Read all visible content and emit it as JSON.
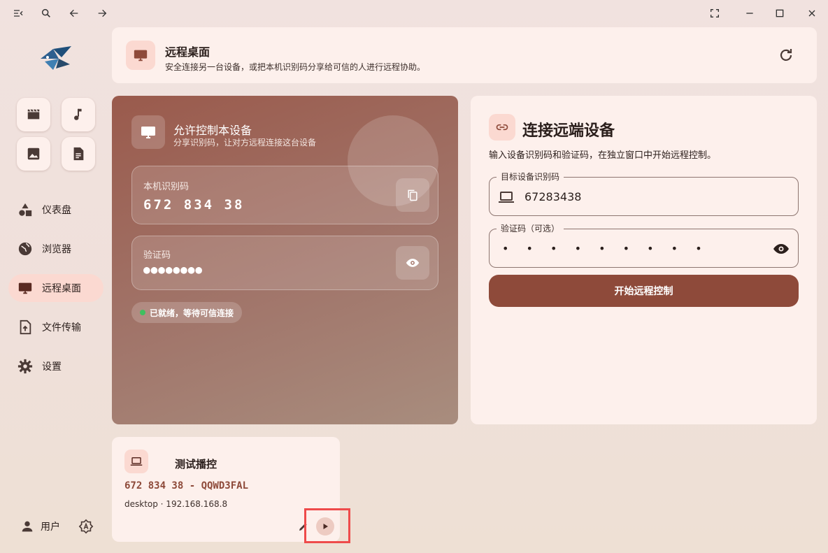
{
  "window": {
    "controls": [
      "menu-icon",
      "search-icon",
      "back-icon",
      "forward-icon",
      "fullscreen-icon",
      "minimize-icon",
      "maximize-icon",
      "close-icon"
    ]
  },
  "sidebar": {
    "quick": [
      "video-icon",
      "music-icon",
      "image-icon",
      "document-icon"
    ],
    "items": [
      {
        "label": "仪表盘",
        "icon": "dashboard-icon",
        "active": false
      },
      {
        "label": "浏览器",
        "icon": "globe-icon",
        "active": false
      },
      {
        "label": "远程桌面",
        "icon": "monitor-icon",
        "active": true
      },
      {
        "label": "文件传输",
        "icon": "file-upload-icon",
        "active": false
      },
      {
        "label": "设置",
        "icon": "gear-icon",
        "active": false
      }
    ],
    "user_label": "用户"
  },
  "header": {
    "title": "远程桌面",
    "subtitle": "安全连接另一台设备，或把本机识别码分享给可信的人进行远程协助。"
  },
  "allow": {
    "title": "允许控制本设备",
    "subtitle": "分享识别码，让对方远程连接这台设备",
    "id_label": "本机识别码",
    "id_value": "672 834 38",
    "code_label": "验证码",
    "code_value": "●●●●●●●●",
    "status": "已就绪，等待可信连接"
  },
  "connect": {
    "title": "连接远端设备",
    "subtitle": "输入设备识别码和验证码，在独立窗口中开始远程控制。",
    "target_label": "目标设备识别码",
    "target_value": "67283438",
    "code_label": "验证码（可选）",
    "code_value": "• • • • • • • • •",
    "button": "开始远程控制"
  },
  "device": {
    "name": "测试播控",
    "code": "672 834 38 - QQWD3FAL",
    "meta": "desktop · 192.168.168.8"
  },
  "colors": {
    "accent": "#8e4a3a",
    "accent_light": "#fbd9d1",
    "card": "#fdf0ec",
    "status_green": "#3fbf5f",
    "highlight": "#ee4b4b"
  }
}
